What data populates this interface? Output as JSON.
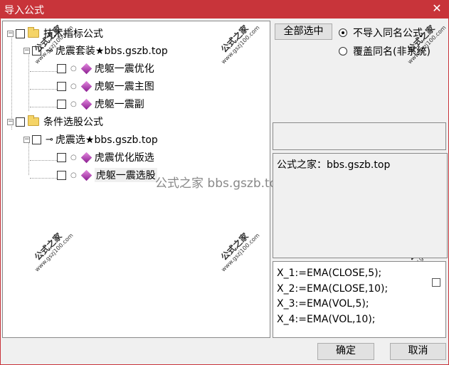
{
  "window": {
    "title": "导入公式",
    "close_icon": "close-icon"
  },
  "tree": {
    "nodes": [
      {
        "id": "tech",
        "label": "技术指标公式",
        "expander": "−"
      },
      {
        "id": "huzhen-pkg",
        "label": "虎震套装★bbs.gszb.top",
        "expander": "−"
      },
      {
        "id": "youhua",
        "label": "虎躯一震优化"
      },
      {
        "id": "zhutu",
        "label": "虎躯一震主图"
      },
      {
        "id": "fu",
        "label": "虎躯一震副"
      },
      {
        "id": "cond",
        "label": "条件选股公式",
        "expander": "−"
      },
      {
        "id": "huzhen-select",
        "label": "虎震选★bbs.gszb.top",
        "expander": "−"
      },
      {
        "id": "youhuaban",
        "label": "虎震优化版选"
      },
      {
        "id": "xuangu",
        "label": "虎躯一震选股"
      }
    ]
  },
  "watermark": {
    "line1": "公式之家",
    "line2": "www.gszj100.com"
  },
  "overlay_text": "公式之家 bbs.gszb.top",
  "actions": {
    "select_all": "全部选中",
    "radio_skip": "不导入同名公式",
    "radio_overwrite": "覆盖同名(非系统)"
  },
  "description": "公式之家：bbs.gszb.top",
  "code_lines": [
    "X_1:=EMA(CLOSE,5);",
    "X_2:=EMA(CLOSE,10);",
    "X_3:=EMA(VOL,5);",
    "X_4:=EMA(VOL,10);"
  ],
  "footer": {
    "ok": "确定",
    "cancel": "取消"
  },
  "colors": {
    "titlebar": "#c8343a",
    "formula_icon": "#a23aa8",
    "folder": "#f5d467"
  }
}
